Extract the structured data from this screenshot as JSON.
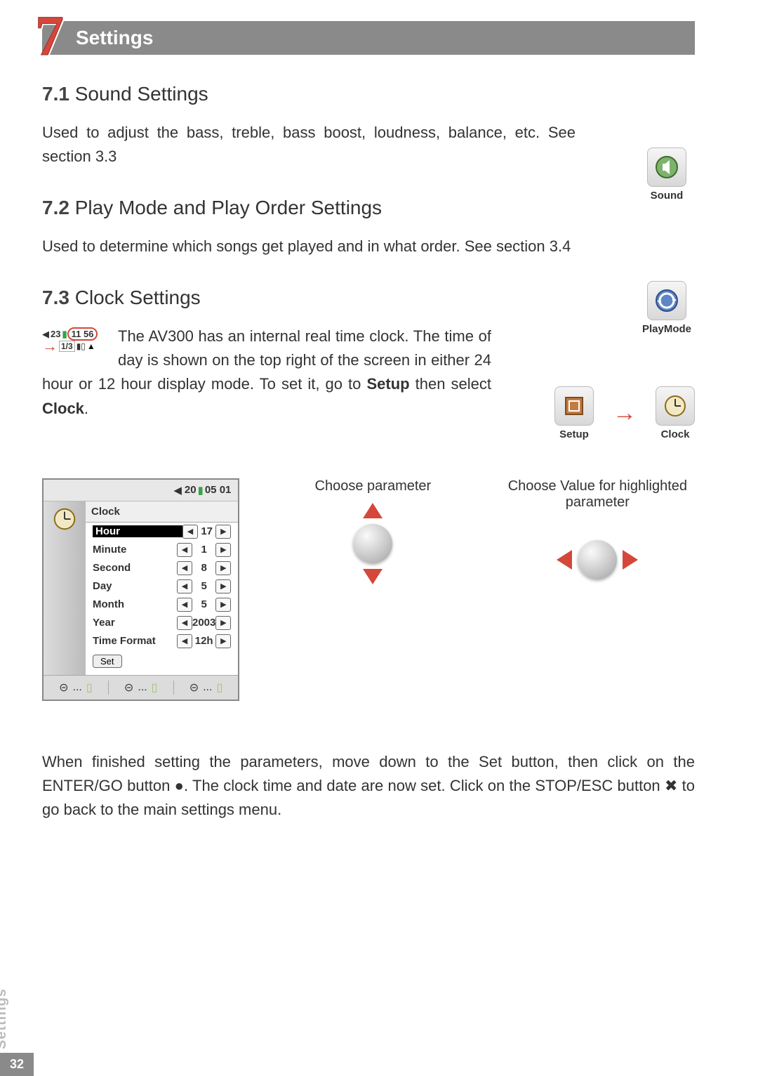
{
  "chapter": {
    "number": "7",
    "title": "Settings"
  },
  "page_number": "32",
  "side_tab": "Settings",
  "sections": {
    "s1": {
      "num": "7.1",
      "title": "Sound Settings",
      "text": "Used to adjust the bass, treble, bass boost, loudness, balance, etc. See section 3.3"
    },
    "s2": {
      "num": "7.2",
      "title": "Play Mode and Play Order Settings",
      "text": "Used to determine which songs get played and in what order. See section 3.4"
    },
    "s3": {
      "num": "7.3",
      "title": "Clock Settings",
      "text_a": "The AV300 has an internal real time clock. The time of day is shown on the top right of the screen in either 24 hour or 12 hour display mode. To set it, go to ",
      "text_b": " then select ",
      "kw_setup": "Setup",
      "kw_clock": "Clock",
      "period": ".",
      "closing_a": "When finished setting the parameters, move down to the Set button, then click on the ENTER/GO button ",
      "closing_b": ". The clock time and date are now set. Click on the STOP/ESC button ",
      "closing_c": " to go back to the main settings menu."
    }
  },
  "side_icons": {
    "sound": "Sound",
    "playmode": "PlayMode",
    "setup": "Setup",
    "clock": "Clock"
  },
  "clock_illus": {
    "speaker": "◀",
    "left": "23",
    "mid": "11",
    "right": "56",
    "bot_left": "1/3",
    "bot_icons": "▮▯",
    "tri": "▲"
  },
  "clock_shot": {
    "status": {
      "speaker": "◀",
      "time": "20",
      "sep": "05",
      "sec": "01",
      "batt": "▮"
    },
    "title": "Clock",
    "rows": [
      {
        "name": "Hour",
        "value": "17",
        "selected": true
      },
      {
        "name": "Minute",
        "value": "1",
        "selected": false
      },
      {
        "name": "Second",
        "value": "8",
        "selected": false
      },
      {
        "name": "Day",
        "value": "5",
        "selected": false
      },
      {
        "name": "Month",
        "value": "5",
        "selected": false
      },
      {
        "name": "Year",
        "value": "2003",
        "selected": false
      },
      {
        "name": "Time Format",
        "value": "12h",
        "selected": false
      }
    ],
    "set_label": "Set",
    "bottom_placeholder": "..."
  },
  "nav": {
    "choose_param": "Choose parameter",
    "choose_value": "Choose Value for highlighted parameter"
  },
  "glyphs": {
    "enter": "●",
    "stop": "✖",
    "left": "◀",
    "right": "▶"
  }
}
